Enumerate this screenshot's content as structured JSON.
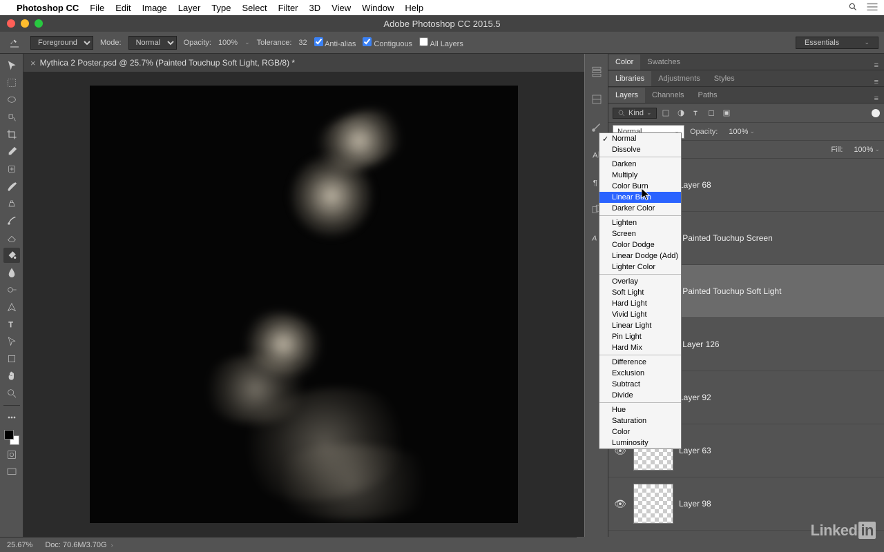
{
  "menubar": {
    "app_name": "Photoshop CC",
    "items": [
      "File",
      "Edit",
      "Image",
      "Layer",
      "Type",
      "Select",
      "Filter",
      "3D",
      "View",
      "Window",
      "Help"
    ]
  },
  "window": {
    "title": "Adobe Photoshop CC 2015.5"
  },
  "options_bar": {
    "foreground": "Foreground",
    "mode_label": "Mode:",
    "mode_value": "Normal",
    "opacity_label": "Opacity:",
    "opacity_value": "100%",
    "tolerance_label": "Tolerance:",
    "tolerance_value": "32",
    "antialias": "Anti-alias",
    "contiguous": "Contiguous",
    "all_layers": "All Layers",
    "workspace": "Essentials"
  },
  "document": {
    "tab_title": "Mythica 2 Poster.psd @ 25.7% (Painted Touchup Soft Light, RGB/8) *"
  },
  "panels": {
    "group1": [
      "Color",
      "Swatches"
    ],
    "group1_active": "Color",
    "group2": [
      "Libraries",
      "Adjustments",
      "Styles"
    ],
    "group2_active": "Libraries",
    "group3": [
      "Layers",
      "Channels",
      "Paths"
    ],
    "group3_active": "Layers"
  },
  "layers_panel": {
    "filter_kind": "Kind",
    "blend_mode": "Normal",
    "opacity_label": "Opacity:",
    "opacity_value": "100%",
    "fill_label": "Fill:",
    "fill_value": "100%",
    "layers": [
      {
        "name": "Layer 68",
        "visible": true,
        "selected": false,
        "thumb": "dark"
      },
      {
        "name": "Painted Touchup Screen",
        "visible": true,
        "selected": false,
        "thumb": "dark",
        "clip": true
      },
      {
        "name": "Painted Touchup Soft Light",
        "visible": true,
        "selected": true,
        "thumb": "dark",
        "clip": true
      },
      {
        "name": "Layer 126",
        "visible": true,
        "selected": false,
        "thumb": "dark",
        "clip": true
      },
      {
        "name": "Layer 92",
        "visible": true,
        "selected": false,
        "thumb": "dark"
      },
      {
        "name": "Layer 63",
        "visible": true,
        "selected": false,
        "thumb": "checker"
      },
      {
        "name": "Layer 98",
        "visible": true,
        "selected": false,
        "thumb": "checker"
      }
    ]
  },
  "blend_modes": {
    "checked": "Normal",
    "highlighted": "Linear Burn",
    "groups": [
      [
        "Normal",
        "Dissolve"
      ],
      [
        "Darken",
        "Multiply",
        "Color Burn",
        "Linear Burn",
        "Darker Color"
      ],
      [
        "Lighten",
        "Screen",
        "Color Dodge",
        "Linear Dodge (Add)",
        "Lighter Color"
      ],
      [
        "Overlay",
        "Soft Light",
        "Hard Light",
        "Vivid Light",
        "Linear Light",
        "Pin Light",
        "Hard Mix"
      ],
      [
        "Difference",
        "Exclusion",
        "Subtract",
        "Divide"
      ],
      [
        "Hue",
        "Saturation",
        "Color",
        "Luminosity"
      ]
    ]
  },
  "status_bar": {
    "zoom": "25.67%",
    "doc": "Doc: 70.6M/3.70G"
  },
  "footer_brand": "Linked"
}
